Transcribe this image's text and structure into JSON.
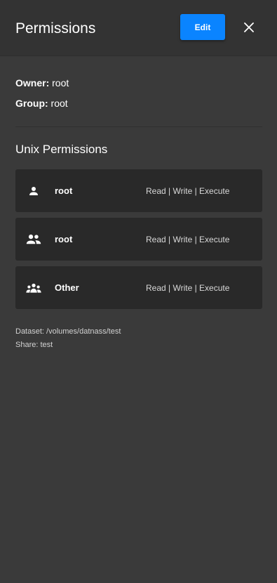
{
  "header": {
    "title": "Permissions",
    "edit_label": "Edit",
    "close_icon": "close-icon"
  },
  "info": {
    "owner_label": "Owner:",
    "owner_value": "root",
    "group_label": "Group:",
    "group_value": "root"
  },
  "section": {
    "title": "Unix Permissions"
  },
  "permissions": [
    {
      "icon": "user-icon",
      "name": "root",
      "rights": "Read | Write | Execute"
    },
    {
      "icon": "group-icon",
      "name": "root",
      "rights": "Read | Write | Execute"
    },
    {
      "icon": "others-icon",
      "name": "Other",
      "rights": "Read | Write | Execute"
    }
  ],
  "footer": {
    "dataset": "Dataset: /volumes/datnass/test",
    "share": "Share: test"
  },
  "colors": {
    "accent": "#0a84ff",
    "background": "#3a3a3a",
    "card": "#292929"
  }
}
